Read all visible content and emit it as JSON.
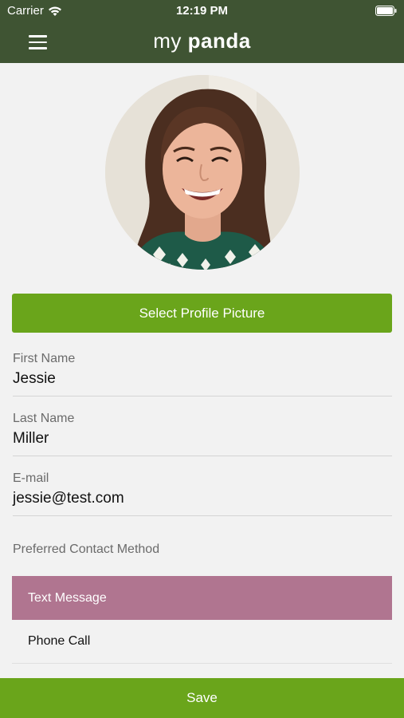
{
  "status_bar": {
    "carrier": "Carrier",
    "time": "12:19 PM"
  },
  "header": {
    "logo_light": "my",
    "logo_bold": "panda",
    "background": "#3f5433"
  },
  "profile": {
    "select_picture_label": "Select Profile Picture"
  },
  "form": {
    "first_name": {
      "label": "First Name",
      "value": "Jessie"
    },
    "last_name": {
      "label": "Last Name",
      "value": "Miller"
    },
    "email": {
      "label": "E-mail",
      "value": "jessie@test.com"
    }
  },
  "contact": {
    "label": "Preferred Contact Method",
    "options": [
      {
        "label": "Text Message",
        "selected": true
      },
      {
        "label": "Phone Call",
        "selected": false
      }
    ]
  },
  "footer": {
    "save_label": "Save"
  },
  "colors": {
    "accent_green": "#6aa51b",
    "selected_option": "#b07590",
    "header_green": "#3f5433"
  },
  "icons": [
    "wifi-icon",
    "battery-icon",
    "hamburger-menu-icon"
  ]
}
